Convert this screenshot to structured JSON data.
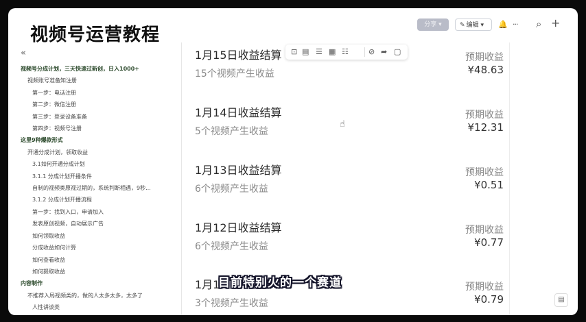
{
  "banner": "视频号运营教程",
  "header": {
    "share_label": "分享 ▾",
    "edit_label": "编辑",
    "edit_caret": "▾"
  },
  "icons": {
    "edit": "✎",
    "bell": "🔔",
    "more": "···",
    "search": "⌕",
    "add": "+",
    "collapse": "«",
    "cursor": "☝"
  },
  "toc": [
    {
      "level": 0,
      "label": "视频号分成计划，三天快速过新创，日入1000+"
    },
    {
      "level": 1,
      "label": "视频账号准备知注册"
    },
    {
      "level": 2,
      "label": "第一步：电话注册"
    },
    {
      "level": 2,
      "label": "第二步：微信注册"
    },
    {
      "level": 2,
      "label": "第三步：登录设备准备"
    },
    {
      "level": 2,
      "label": "第四步：视频号注册"
    },
    {
      "level": 0,
      "label": "这里9种爆款形式"
    },
    {
      "level": 1,
      "label": "开通分成计划，领取收益"
    },
    {
      "level": 2,
      "label": "3.1如何开通分成计划"
    },
    {
      "level": 2,
      "label": "3.1.1 分成计划开播条件"
    },
    {
      "level": 2,
      "label": "自制的视频类原视过期的，系统判断相遇，9秒..."
    },
    {
      "level": 2,
      "label": "3.1.2 分成计划开播流程"
    },
    {
      "level": 2,
      "label": "第一步：找到入口，申请加入"
    },
    {
      "level": 2,
      "label": "发表原创视频，自动展示广告"
    },
    {
      "level": 2,
      "label": "如何领取收益"
    },
    {
      "level": 2,
      "label": "分成收益如何计算"
    },
    {
      "level": 2,
      "label": "如何查看收益"
    },
    {
      "level": 2,
      "label": "如何提取收益"
    },
    {
      "level": 0,
      "label": "内容制作"
    },
    {
      "level": 1,
      "label": "不推荐入局视频类的，做的人太多太多，太多了"
    },
    {
      "level": 2,
      "label": "人性讲谈类"
    }
  ],
  "toolbar": [
    "⊡",
    "▤",
    "☰",
    "▦",
    "☷",
    "⊘",
    "➦",
    "▢"
  ],
  "cards": [
    {
      "title": "1月15日收益结算",
      "subtitle": "15个视频产生收益",
      "earn_label": "预期收益",
      "earn_value": "¥48.63"
    },
    {
      "title": "1月14日收益结算",
      "subtitle": "5个视频产生收益",
      "earn_label": "预期收益",
      "earn_value": "¥12.31"
    },
    {
      "title": "1月13日收益结算",
      "subtitle": "6个视频产生收益",
      "earn_label": "预期收益",
      "earn_value": "¥0.51"
    },
    {
      "title": "1月12日收益结算",
      "subtitle": "6个视频产生收益",
      "earn_label": "预期收益",
      "earn_value": "¥0.77"
    },
    {
      "title": "1月1",
      "subtitle": "3个视频产生收益",
      "earn_label": "预期收益",
      "earn_value": "¥0.79"
    }
  ],
  "caption": "目前特别火的一个赛道",
  "float_button": "▤"
}
